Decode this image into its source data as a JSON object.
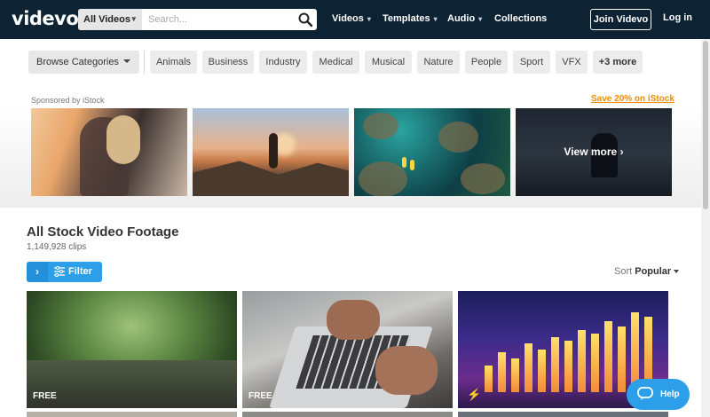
{
  "header": {
    "logo": "videvo",
    "search_scope": "All Videos",
    "search_placeholder": "Search...",
    "nav": [
      {
        "label": "Videos"
      },
      {
        "label": "Templates"
      },
      {
        "label": "Audio"
      },
      {
        "label": "Collections"
      }
    ],
    "join_label": "Join Videvo",
    "login_label": "Log in"
  },
  "categories": {
    "browse_label": "Browse Categories",
    "chips": [
      "Animals",
      "Business",
      "Industry",
      "Medical",
      "Musical",
      "Nature",
      "People",
      "Sport",
      "VFX"
    ],
    "more_label": "+3 more"
  },
  "sponsored": {
    "label": "Sponsored by iStock",
    "save_link": "Save 20% on iStock",
    "view_more": "View more"
  },
  "main": {
    "title": "All Stock Video Footage",
    "count": "1,149,928 clips",
    "filter_label": "Filter",
    "sort_label": "Sort",
    "sort_value": "Popular",
    "videos": [
      {
        "badge": "FREE"
      },
      {
        "badge": "FREE"
      },
      {
        "badge": ""
      }
    ]
  },
  "help": {
    "label": "Help"
  },
  "colors": {
    "header_bg": "#0d2233",
    "accent_blue": "#2d9ee8",
    "istock_orange": "#f08a00"
  }
}
